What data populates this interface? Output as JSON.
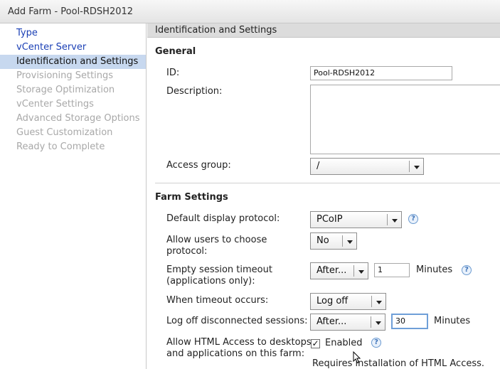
{
  "window": {
    "title": "Add Farm - Pool-RDSH2012"
  },
  "sidebar": {
    "items": [
      {
        "label": "Type",
        "state": "link"
      },
      {
        "label": "vCenter Server",
        "state": "link"
      },
      {
        "label": "Identification and Settings",
        "state": "current"
      },
      {
        "label": "Provisioning Settings",
        "state": "disabled"
      },
      {
        "label": "Storage Optimization",
        "state": "disabled"
      },
      {
        "label": "vCenter Settings",
        "state": "disabled"
      },
      {
        "label": "Advanced Storage Options",
        "state": "disabled"
      },
      {
        "label": "Guest Customization",
        "state": "disabled"
      },
      {
        "label": "Ready to Complete",
        "state": "disabled"
      }
    ]
  },
  "main": {
    "header": "Identification and Settings",
    "general": {
      "title": "General",
      "id_label": "ID:",
      "id_value": "Pool-RDSH2012",
      "description_label": "Description:",
      "description_value": "",
      "access_group_label": "Access group:",
      "access_group_value": "/"
    },
    "farm": {
      "title": "Farm Settings",
      "protocol_label": "Default display protocol:",
      "protocol_value": "PCoIP",
      "allow_choose_line1": "Allow users to choose",
      "allow_choose_line2": "protocol:",
      "allow_choose_value": "No",
      "empty_timeout_line1": "Empty session timeout",
      "empty_timeout_line2": "(applications only):",
      "empty_timeout_mode": "After...",
      "empty_timeout_value": "1",
      "empty_timeout_unit": "Minutes",
      "when_timeout_label": "When timeout occurs:",
      "when_timeout_value": "Log off",
      "logoff_disc_label": "Log off disconnected sessions:",
      "logoff_disc_mode": "After...",
      "logoff_disc_value": "30",
      "logoff_disc_unit": "Minutes",
      "html_access_line1": "Allow HTML Access to desktops",
      "html_access_line2": "and applications on this farm:",
      "html_access_checked": true,
      "html_access_check_label": "Enabled",
      "html_access_note": "Requires installation of HTML Access."
    },
    "help_glyph": "?",
    "check_glyph": "✓"
  },
  "colors": {
    "link": "#1a3fb5",
    "current_bg": "#c7d8ef",
    "disabled": "#a8a8a8",
    "header_bg": "#dcdcdc",
    "focus": "#6f9fd8"
  }
}
